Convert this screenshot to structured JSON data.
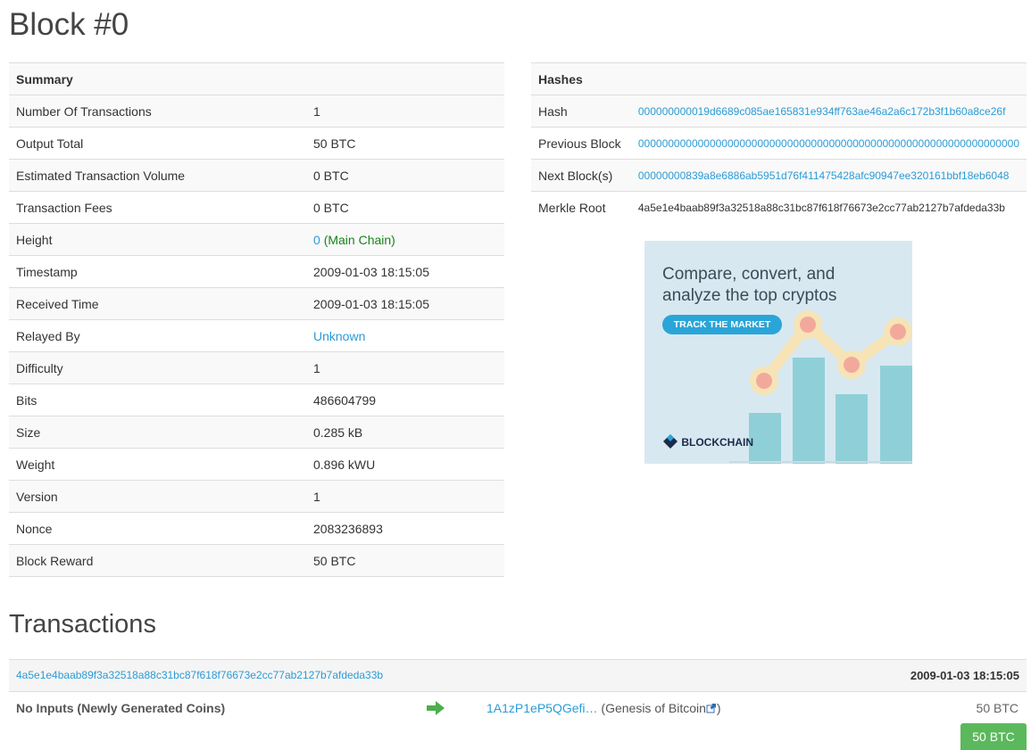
{
  "page": {
    "title": "Block #0"
  },
  "summary": {
    "heading": "Summary",
    "rows": [
      {
        "label": "Number Of Transactions",
        "value": "1"
      },
      {
        "label": "Output Total",
        "value": "50 BTC"
      },
      {
        "label": "Estimated Transaction Volume",
        "value": "0 BTC"
      },
      {
        "label": "Transaction Fees",
        "value": "0 BTC"
      },
      {
        "label": "Height",
        "value": "0",
        "suffix": "(Main Chain)"
      },
      {
        "label": "Timestamp",
        "value": "2009-01-03 18:15:05"
      },
      {
        "label": "Received Time",
        "value": "2009-01-03 18:15:05"
      },
      {
        "label": "Relayed By",
        "value": "Unknown"
      },
      {
        "label": "Difficulty",
        "value": "1"
      },
      {
        "label": "Bits",
        "value": "486604799"
      },
      {
        "label": "Size",
        "value": "0.285 kB"
      },
      {
        "label": "Weight",
        "value": "0.896 kWU"
      },
      {
        "label": "Version",
        "value": "1"
      },
      {
        "label": "Nonce",
        "value": "2083236893"
      },
      {
        "label": "Block Reward",
        "value": "50 BTC"
      }
    ]
  },
  "hashes": {
    "heading": "Hashes",
    "rows": [
      {
        "label": "Hash",
        "value": "000000000019d6689c085ae165831e934ff763ae46a2a6c172b3f1b60a8ce26f"
      },
      {
        "label": "Previous Block",
        "value": "0000000000000000000000000000000000000000000000000000000000000000"
      },
      {
        "label": "Next Block(s)",
        "value": "00000000839a8e6886ab5951d76f411475428afc90947ee320161bbf18eb6048"
      },
      {
        "label": "Merkle Root",
        "value": "4a5e1e4baab89f3a32518a88c31bc87f618f76673e2cc77ab2127b7afdeda33b"
      }
    ]
  },
  "ad": {
    "headline_line1": "Compare, convert, and",
    "headline_line2": "analyze the top cryptos",
    "cta": "TRACK THE MARKET",
    "brand": "BLOCKCHAIN"
  },
  "transactions": {
    "title": "Transactions",
    "items": [
      {
        "hash": "4a5e1e4baab89f3a32518a88c31bc87f618f76673e2cc77ab2127b7afdeda33b",
        "time": "2009-01-03 18:15:05",
        "inputs": "No Inputs (Newly Generated Coins)",
        "output_address": "1A1zP1eP5QGefi…",
        "output_note_open": "(Genesis of Bitcoin",
        "output_note_close": ")",
        "output_amount": "50 BTC",
        "total": "50 BTC"
      }
    ]
  },
  "colors": {
    "link": "#2b9bd6",
    "main_chain": "#16841b",
    "total_badge": "#5cb85c",
    "arrow": "#4cae4c"
  }
}
